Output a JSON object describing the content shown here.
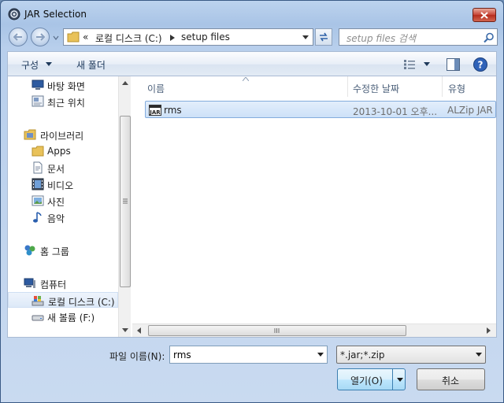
{
  "window": {
    "title": "JAR Selection"
  },
  "nav": {
    "address_prefix": "«",
    "address_segments": [
      "로컬 디스크 (C:)",
      "setup files"
    ],
    "search_placeholder": "setup files 검색"
  },
  "toolbar": {
    "organize_label": "구성",
    "new_folder_label": "새 폴더"
  },
  "sidebar": {
    "items": [
      {
        "label": "바탕 화면",
        "icon": "desktop-icon"
      },
      {
        "label": "최근 위치",
        "icon": "recent-places-icon"
      },
      {
        "label": "라이브러리",
        "icon": "libraries-icon"
      },
      {
        "label": "Apps",
        "icon": "folder-icon"
      },
      {
        "label": "문서",
        "icon": "documents-icon"
      },
      {
        "label": "비디오",
        "icon": "video-icon"
      },
      {
        "label": "사진",
        "icon": "pictures-icon"
      },
      {
        "label": "음악",
        "icon": "music-icon"
      },
      {
        "label": "홈 그룹",
        "icon": "homegroup-icon"
      },
      {
        "label": "컴퓨터",
        "icon": "computer-icon"
      },
      {
        "label": "로컬 디스크 (C:)",
        "icon": "local-disk-icon",
        "selected": true
      },
      {
        "label": "새 볼륨 (F:)",
        "icon": "drive-icon"
      }
    ]
  },
  "columns": {
    "name": "이름",
    "modified": "수정한 날짜",
    "type": "유형"
  },
  "files": [
    {
      "name": "rms",
      "modified": "2013-10-01 오후...",
      "type": "ALZip JAR Fi",
      "icon": "jar-file-icon"
    }
  ],
  "bottom": {
    "filename_label": "파일 이름(N):",
    "filename_value": "rms",
    "filter_value": "*.jar;*.zip",
    "open_label": "열기(O)",
    "cancel_label": "취소"
  },
  "colors": {
    "selection": "#cde1f8",
    "accent": "#3c7fb1",
    "close": "#c8473a"
  }
}
